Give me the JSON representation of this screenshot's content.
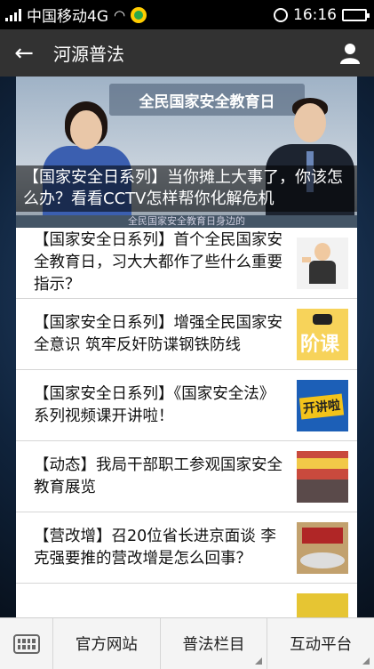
{
  "status_bar": {
    "carrier": "中国移动4G",
    "time": "16:16"
  },
  "app_bar": {
    "title": "河源普法"
  },
  "hero": {
    "banner_text": "全民国家安全教育日",
    "caption": "【国家安全日系列】当你摊上大事了，你该怎么办？看看CCTV怎样帮你化解危机",
    "subline": "全民国家安全教育日身边的"
  },
  "articles": [
    {
      "title": "【国家安全日系列】首个全民国家安全教育日，习大大都作了些什么重要指示？",
      "thumb_icon": "cartoon-leader-thumbnail"
    },
    {
      "title": "【国家安全日系列】增强全民国家安全意识 筑牢反奸防谍钢铁防线",
      "thumb_icon": "anti-spy-poster-thumbnail",
      "thumb_text": "阶课"
    },
    {
      "title": "【国家安全日系列】《国家安全法》系列视频课开讲啦！",
      "thumb_icon": "video-course-thumbnail",
      "thumb_text": "开讲啦"
    },
    {
      "title": "【动态】我局干部职工参观国家安全教育展览",
      "thumb_icon": "exhibition-photo-thumbnail"
    },
    {
      "title": "【营改增】召20位省长进京面谈 李克强要推的营改增是怎么回事？",
      "thumb_icon": "meeting-photo-thumbnail"
    }
  ],
  "bottom_menu": {
    "items": [
      "官方网站",
      "普法栏目",
      "互动平台"
    ]
  }
}
